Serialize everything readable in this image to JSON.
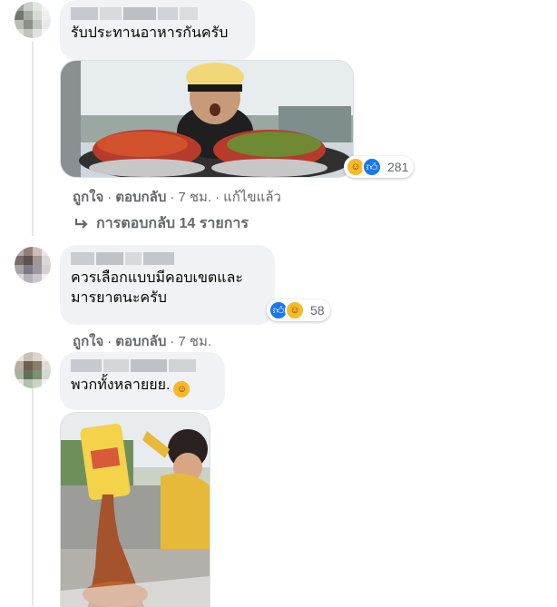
{
  "comments": [
    {
      "text": "รับประทานอาหารกันครับ",
      "actions": {
        "like": "ถูกใจ",
        "reply": "ตอบกลับ",
        "time": "7 ชม.",
        "edited": "แก้ไขแล้ว"
      },
      "reaction_count": "281",
      "replies_label": "การตอบกลับ 14 รายการ",
      "media": "photo-man-with-bowls"
    },
    {
      "text": "ควรเลือกแบบมีคอบเขตและ\nมารยาตนะครับ",
      "actions": {
        "like": "ถูกใจ",
        "reply": "ตอบกลับ",
        "time": "7 ชม."
      },
      "reaction_count": "58"
    },
    {
      "text": "พวกทั้งหลายยย.",
      "media": "photo-pouring-food"
    }
  ],
  "separator": "·",
  "icons": {
    "reply_arrow": "reply-arrow-icon",
    "like": "like-icon",
    "haha": "haha-icon"
  },
  "colors": {
    "bubble": "#f0f2f5",
    "meta": "#65676b",
    "like": "#1877f2",
    "haha": "#f7b928"
  }
}
